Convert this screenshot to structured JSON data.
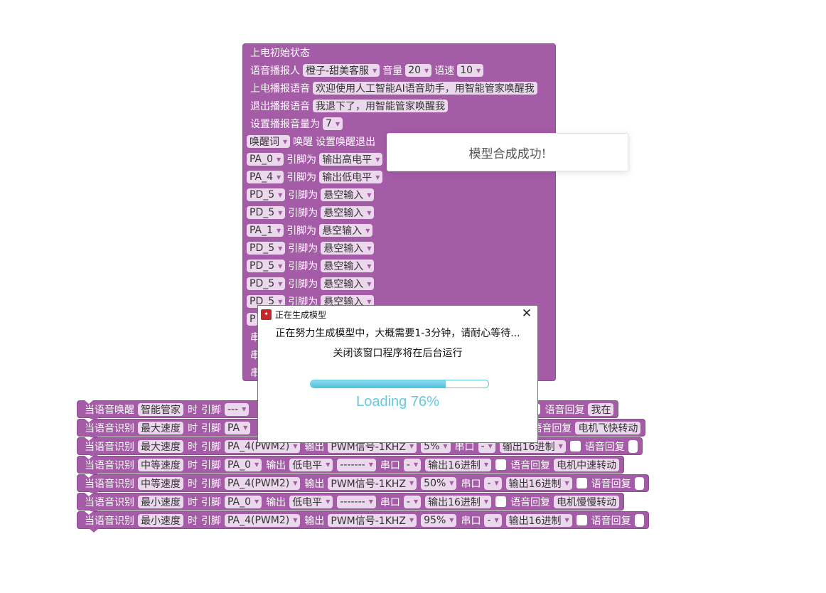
{
  "init": {
    "title": "上电初始状态",
    "voice": {
      "label": "语音播报人",
      "value": "橙子-甜美客服",
      "volume_label": "音量",
      "volume": "20",
      "speed_label": "语速",
      "speed": "10"
    },
    "power_on": {
      "label": "上电播报语音",
      "value": "欢迎使用人工智能AI语音助手，用智能管家唤醒我"
    },
    "exit": {
      "label": "退出播报语音",
      "value": "我退下了，用智能管家唤醒我"
    },
    "set_volume": {
      "label": "设置播报音量为",
      "value": "7"
    },
    "wake": {
      "field": "唤醒词",
      "label1": "唤醒",
      "label2": "设置唤醒退出"
    },
    "pin_label": "引脚为",
    "pins": [
      {
        "pin": "PA_0",
        "state": "输出高电平"
      },
      {
        "pin": "PA_4",
        "state": "输出低电平"
      },
      {
        "pin": "PD_5",
        "state": "悬空输入"
      },
      {
        "pin": "PD_5",
        "state": "悬空输入"
      },
      {
        "pin": "PA_1",
        "state": "悬空输入"
      },
      {
        "pin": "PD_5",
        "state": "悬空输入"
      },
      {
        "pin": "PD_5",
        "state": "悬空输入"
      },
      {
        "pin": "PD_5",
        "state": "悬空输入"
      },
      {
        "pin": "PD_5",
        "state": "悬空输入"
      }
    ],
    "partial": [
      "P",
      "串",
      "串",
      "串"
    ]
  },
  "toast": {
    "text": "模型合成成功!"
  },
  "dialog": {
    "title": "正在生成模型",
    "message": "正在努力生成模型中，大概需要1-3分钟，请耐心等待...",
    "note": "关闭该窗口程序将在后台运行",
    "progress": 0.76,
    "loading_text": "Loading 76%",
    "close_symbol": "✕"
  },
  "labels": {
    "when": "时",
    "pin": "引脚",
    "output": "输出",
    "serial": "串口",
    "reply": "语音回复"
  },
  "events": [
    {
      "head": "当语音唤醒",
      "word": "智能管家",
      "pin": "---",
      "mode": "",
      "param": "",
      "serial": "",
      "fmt": "制",
      "reply": "我在"
    },
    {
      "head": "当语音识别",
      "word": "最大速度",
      "pin": "PA",
      "mode": "",
      "param": "",
      "serial": "",
      "fmt": "制",
      "reply": "电机飞快转动"
    },
    {
      "head": "当语音识别",
      "word": "最大速度",
      "pin": "PA_4(PWM2)",
      "mode": "PWM信号-1KHZ",
      "param": "5%",
      "serial": "-",
      "fmt": "输出16进制",
      "reply": ""
    },
    {
      "head": "当语音识别",
      "word": "中等速度",
      "pin": "PA_0",
      "mode": "低电平",
      "param": "-------",
      "serial": "-",
      "fmt": "输出16进制",
      "reply": "电机中速转动"
    },
    {
      "head": "当语音识别",
      "word": "中等速度",
      "pin": "PA_4(PWM2)",
      "mode": "PWM信号-1KHZ",
      "param": "50%",
      "serial": "-",
      "fmt": "输出16进制",
      "reply": ""
    },
    {
      "head": "当语音识别",
      "word": "最小速度",
      "pin": "PA_0",
      "mode": "低电平",
      "param": "-------",
      "serial": "-",
      "fmt": "输出16进制",
      "reply": "电机慢慢转动"
    },
    {
      "head": "当语音识别",
      "word": "最小速度",
      "pin": "PA_4(PWM2)",
      "mode": "PWM信号-1KHZ",
      "param": "95%",
      "serial": "-",
      "fmt": "输出16进制",
      "reply": ""
    }
  ],
  "colors": {
    "block": "#a55ca7",
    "field": "#ecd8ec",
    "progress": "#5bc8e0"
  }
}
